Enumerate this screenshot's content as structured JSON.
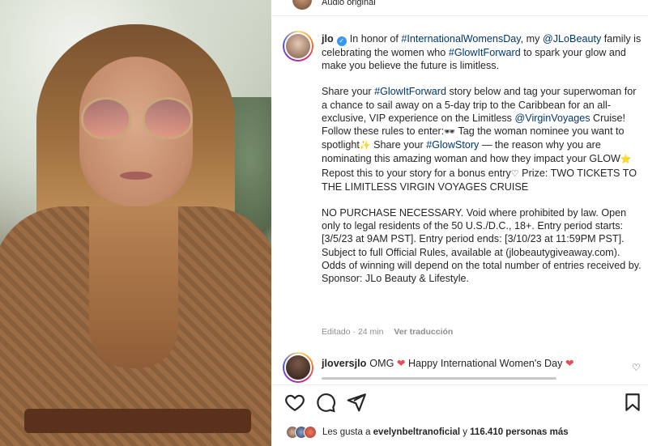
{
  "post_header": {
    "audio_label": "Audio original"
  },
  "caption": {
    "username": "jlo",
    "line1_pre": "In honor of ",
    "tag_iwd": "#InternationalWomensDay",
    "line1_mid": ", my ",
    "mention_beauty": "@JLoBeauty",
    "line1_mid2": " family is celebrating the women who ",
    "tag_glow": "#GlowItForward",
    "line1_post": " to spark your glow and make you believe the future is limitless.",
    "p2_pre": "Share your ",
    "p2_tag": "#GlowItForward",
    "p2_mid": " story below and tag your superwoman for a chance to sail away on a 5-day trip to the Caribbean for an all-exclusive, VIP experience on the Limitless ",
    "p2_mention": "@VirginVoyages",
    "p2_post": " Cruise!",
    "p3_a": "Follow these rules to enter:",
    "emoji_ship": "🕶",
    "p3_b": " Tag the woman nominee you want to spotlight",
    "emoji_spark": "✨",
    "p3_c": " Share your ",
    "p3_tag": "#GlowStory",
    "p3_d": " — the reason why you are nominating this amazing woman and how they impact your GLOW",
    "emoji_star": "⭐",
    "p3_e": " Repost this to your story for a bonus entry",
    "emoji_heart": "♡",
    "p3_f": " Prize: TWO TICKETS TO THE LIMITLESS VIRGIN VOYAGES CRUISE",
    "p4": "NO PURCHASE NECESSARY. Void where prohibited by law. Open only to legal residents of the 50 U.S./D.C., 18+. Entry period starts: [3/5/23 at 9AM PST]. Entry period ends: [3/10/23 at 11:59PM PST]. Subject to full Official Rules, available at (jlobeautygiveaway.com). Odds of winning will depend on the total number of entries received by. Sponsor: JLo Beauty & Lifestyle."
  },
  "meta": {
    "edited": "Editado · 24 min",
    "translate": "Ver traducción"
  },
  "comment": {
    "username": "jloversjlo",
    "text_a": "OMG ",
    "heart": "❤",
    "text_b": " Happy International Women's Day ",
    "heart2": "❤",
    "like_icon": "♡"
  },
  "likes": {
    "prefix": "Les gusta a ",
    "user": "evelynbeltranoficial",
    "mid": " y ",
    "count": "116.410 personas más"
  },
  "icons": [
    "heart-icon",
    "comment-icon",
    "share-icon",
    "bookmark-icon",
    "verified-icon"
  ],
  "colors": {
    "link": "#00376b",
    "verified": "#3897f0",
    "heart": "#ed4956",
    "muted": "#8e8e8e"
  }
}
